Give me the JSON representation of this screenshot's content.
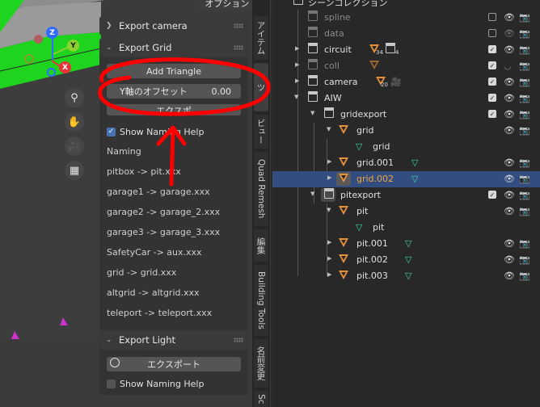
{
  "viewport": {
    "options_label": "オプション",
    "gizmo": {
      "z": "Z",
      "y": "Y",
      "x": "X"
    }
  },
  "panel": {
    "export_camera": {
      "title": "Export camera"
    },
    "export_grid": {
      "title": "Export Grid",
      "add_triangle": "Add Triangle",
      "offset_label": "Y軸のオフセット",
      "offset_value": "0.00",
      "export_label": "エクスポ",
      "show_naming_help": "Show Naming Help",
      "naming_title": "Naming",
      "naming_rules": [
        "pitbox -> pit.xxx",
        "garage1 -> garage.xxx",
        "garage2 -> garage_2.xxx",
        "garage3 -> garage_3.xxx",
        "SafetyCar -> aux.xxx",
        "grid -> grid.xxx",
        "altgrid -> altgrid.xxx",
        "teleport -> teleport.xxx"
      ]
    },
    "export_light": {
      "title": "Export Light",
      "export_label": "エクスポート",
      "show_naming_help": "Show Naming Help"
    }
  },
  "tabs": [
    "アイテム",
    "ツ",
    "ビュー",
    "Quad Remesh",
    "編集",
    "Building Tools",
    "名前変更",
    "Sc"
  ],
  "outliner": {
    "scene_collection": "シーンコレクション",
    "rows": {
      "spline": "spline",
      "data": "data",
      "circuit": "circuit",
      "circuit_mesh_count": "34",
      "circuit_col_count": "4",
      "coll": "coll",
      "camera": "camera",
      "camera_count": "20",
      "aiw": "AIW",
      "gridexport": "gridexport",
      "grid": "grid",
      "grid_data": "grid",
      "grid001": "grid.001",
      "grid002": "grid.002",
      "pitexport": "pitexport",
      "pit": "pit",
      "pit_data": "pit",
      "pit001": "pit.001",
      "pit002": "pit.002",
      "pit003": "pit.003"
    }
  },
  "colors": {
    "accent_blue": "#4772b3",
    "selection": "#334d80",
    "mesh_orange": "#e8913c",
    "highlight_text": "#f0a540",
    "annotation_red": "#ff0000",
    "viewport_green": "#1ed41e"
  }
}
